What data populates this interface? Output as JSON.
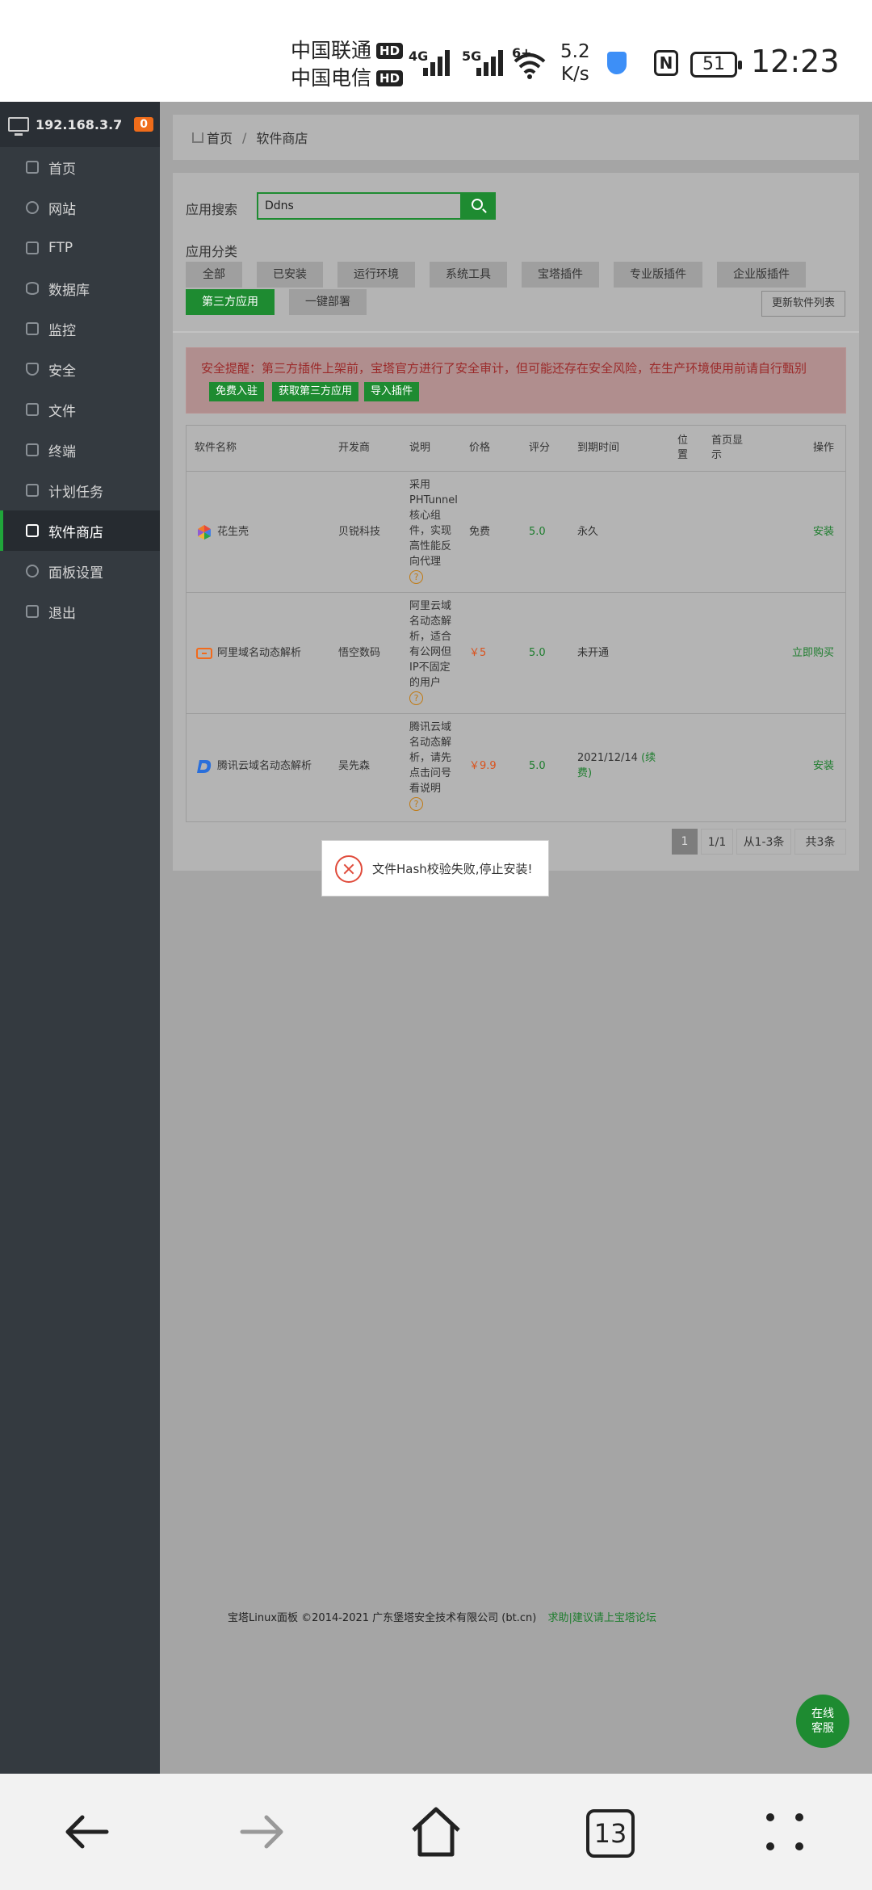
{
  "status_bar": {
    "carrier1": "中国联通",
    "carrier2": "中国电信",
    "hd": "HD",
    "net1": "4G",
    "net2": "5G",
    "wifi": "6+",
    "speed_value": "5.2",
    "speed_unit": "K/s",
    "battery": "51",
    "time": "12:23"
  },
  "sidebar": {
    "ip": "192.168.3.7",
    "badge": "0",
    "items": [
      {
        "label": "首页",
        "icon": "home-icon"
      },
      {
        "label": "网站",
        "icon": "globe-icon"
      },
      {
        "label": "FTP",
        "icon": "ftp-icon"
      },
      {
        "label": "数据库",
        "icon": "database-icon"
      },
      {
        "label": "监控",
        "icon": "monitor-icon"
      },
      {
        "label": "安全",
        "icon": "shield-icon"
      },
      {
        "label": "文件",
        "icon": "folder-icon"
      },
      {
        "label": "终端",
        "icon": "terminal-icon"
      },
      {
        "label": "计划任务",
        "icon": "calendar-icon"
      },
      {
        "label": "软件商店",
        "icon": "apps-icon",
        "active": true
      },
      {
        "label": "面板设置",
        "icon": "gear-icon"
      },
      {
        "label": "退出",
        "icon": "logout-icon"
      }
    ]
  },
  "breadcrumb": {
    "home": "首页",
    "sep": "/",
    "current": "软件商店"
  },
  "search": {
    "label": "应用搜索",
    "value": "Ddns"
  },
  "category": {
    "label": "应用分类",
    "items": [
      "全部",
      "已安装",
      "运行环境",
      "系统工具",
      "宝塔插件",
      "专业版插件",
      "企业版插件",
      "第三方应用",
      "一键部署"
    ],
    "active_index": 7,
    "update_button": "更新软件列表"
  },
  "alert": {
    "text": "安全提醒：第三方插件上架前，宝塔官方进行了安全审计，但可能还存在安全风险，在生产环境使用前请自行甄别",
    "buttons": [
      "免费入驻",
      "获取第三方应用",
      "导入插件"
    ]
  },
  "table": {
    "headers": [
      "软件名称",
      "开发商",
      "说明",
      "价格",
      "评分",
      "到期时间",
      "位置",
      "首页显示",
      "操作"
    ],
    "header_position_lines": [
      "位",
      "置"
    ],
    "header_home_lines": [
      "首页显",
      "示"
    ],
    "rows": [
      {
        "name": "花生壳",
        "icon": "peanut-shell-icon",
        "vendor": "贝锐科技",
        "desc_lines": [
          "采用",
          "PHTunnel",
          "核心组",
          "件，实现",
          "高性能反",
          "向代理"
        ],
        "price": "免费",
        "score": "5.0",
        "expire": "永久",
        "action": "安装"
      },
      {
        "name": "阿里域名动态解析",
        "icon": "aliyun-icon",
        "vendor": "悟空数码",
        "desc_lines": [
          "阿里云域",
          "名动态解",
          "析，适合",
          "有公网但",
          "IP不固定",
          "的用户"
        ],
        "price": "￥5",
        "score": "5.0",
        "expire": "未开通",
        "action": "立即购买"
      },
      {
        "name": "腾讯云域名动态解析",
        "icon": "dnspod-icon",
        "vendor": "吴先森",
        "desc_lines": [
          "腾讯云域",
          "名动态解",
          "析，请先",
          "点击问号",
          "看说明"
        ],
        "price": "￥9.9",
        "score": "5.0",
        "expire": "2021/12/14",
        "expire_link_part1": "(续",
        "expire_link_part2": "费)",
        "action": "安装"
      }
    ],
    "help_mark": "?"
  },
  "pagination": {
    "current": "1",
    "pages": "1/1",
    "range": "从1-3条",
    "total": "共3条"
  },
  "toast": {
    "message": "文件Hash校验失败,停止安装!"
  },
  "footer": {
    "copyright": "宝塔Linux面板 ©2014-2021 广东堡塔安全技术有限公司 (bt.cn)",
    "link": "求助|建议请上宝塔论坛"
  },
  "chat": {
    "line1": "在线",
    "line2": "客服"
  },
  "nav": {
    "tabs_count": "13"
  }
}
